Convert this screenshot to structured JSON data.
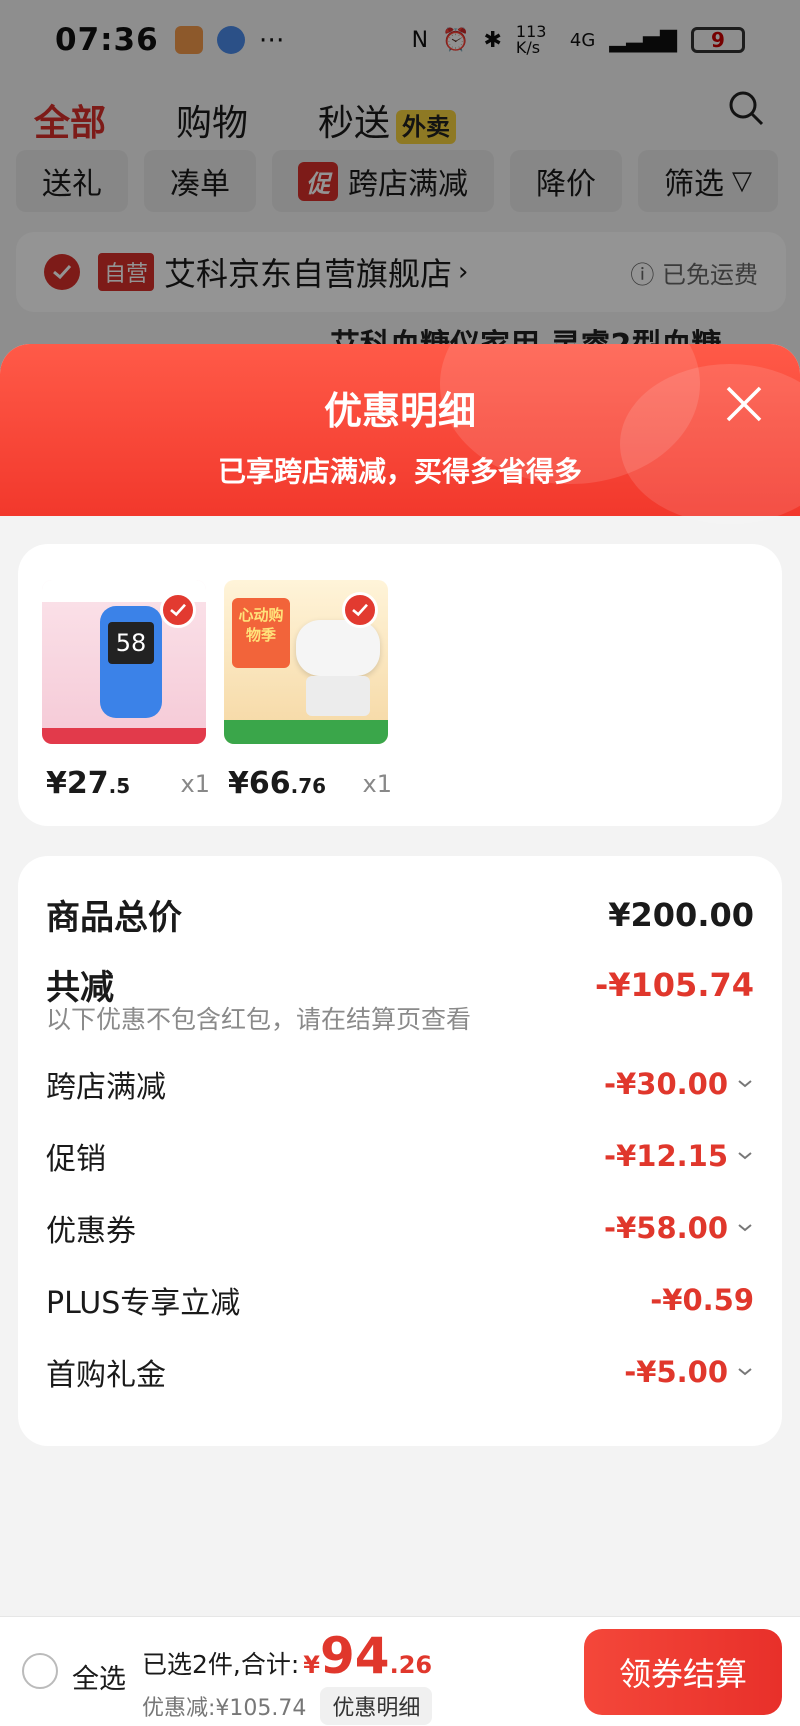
{
  "status_bar": {
    "time": "07:36",
    "net_speed": "113 K/s",
    "signal": "4G",
    "battery": "9"
  },
  "top_tabs": [
    {
      "label": "全部"
    },
    {
      "label": "购物"
    },
    {
      "label": "秒送",
      "badge": "外卖"
    }
  ],
  "filters": [
    {
      "label": "送礼"
    },
    {
      "label": "凑单"
    },
    {
      "label": "跨店满减",
      "tag": "促"
    },
    {
      "label": "降价"
    },
    {
      "label": "筛选"
    }
  ],
  "store": {
    "self_tag": "自营",
    "name": "艾科京东自营旗舰店",
    "shipping": "已免运费"
  },
  "peek_title": "艾科血糖仪家用 灵睿2型血糖",
  "sheet": {
    "title": "优惠明细",
    "subtitle": "已享跨店满减，买得多省得多"
  },
  "products": [
    {
      "price_int": "¥27",
      "price_dec": ".5",
      "qty": "x1",
      "img_label": "58",
      "colors": {
        "bg": "#f7d6e0",
        "device": "#3b82e8"
      }
    },
    {
      "price_int": "¥66",
      "price_dec": ".76",
      "qty": "x1",
      "img_label": "心动购物季",
      "colors": {
        "bg": "#f6e7c8",
        "device": "#f2f2f2"
      }
    }
  ],
  "summary": {
    "total_label": "商品总价",
    "total_value": "¥200.00",
    "reduce_label": "共减",
    "reduce_value": "-¥105.74",
    "note": "以下优惠不包含红包，请在结算页查看",
    "items": [
      {
        "label": "跨店满减",
        "value": "-¥30.00",
        "expandable": true
      },
      {
        "label": "促销",
        "value": "-¥12.15",
        "expandable": true
      },
      {
        "label": "优惠券",
        "value": "-¥58.00",
        "expandable": true
      },
      {
        "label": "PLUS专享立减",
        "value": "-¥0.59",
        "expandable": false
      },
      {
        "label": "首购礼金",
        "value": "-¥5.00",
        "expandable": true
      }
    ]
  },
  "bottom_bar": {
    "select_all": "全选",
    "selected_text": "已选2件,合计:",
    "currency": "¥",
    "total_int": "94",
    "total_dec": ".26",
    "saved_text": "优惠减:¥105.74",
    "detail_button": "优惠明细",
    "checkout_button": "领券结算"
  },
  "colors": {
    "accent": "#e0372c",
    "header_gradient_top": "#ff5a48",
    "header_gradient_bottom": "#f2382c"
  }
}
